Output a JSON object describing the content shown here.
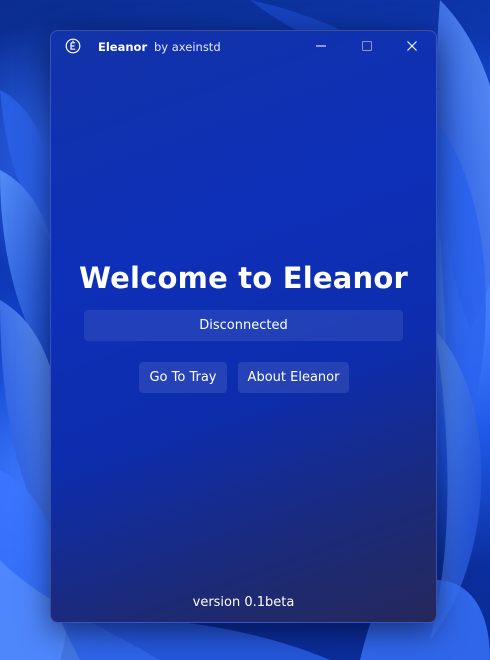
{
  "window": {
    "title": "Eleanor",
    "subtitle": "by axeinstd",
    "app_icon": "eleanor-logo-icon",
    "controls": {
      "minimize_icon": "minimize-icon",
      "maximize_icon": "maximize-icon",
      "close_icon": "close-icon"
    }
  },
  "main": {
    "heading": "Welcome to Eleanor",
    "status": "Disconnected",
    "buttons": {
      "tray_label": "Go To Tray",
      "about_label": "About Eleanor"
    },
    "version": "version 0.1beta"
  },
  "colors": {
    "window_bg": "#0e2fb8",
    "button_bg": "rgba(255,255,255,0.10)",
    "text": "#ffffff"
  }
}
